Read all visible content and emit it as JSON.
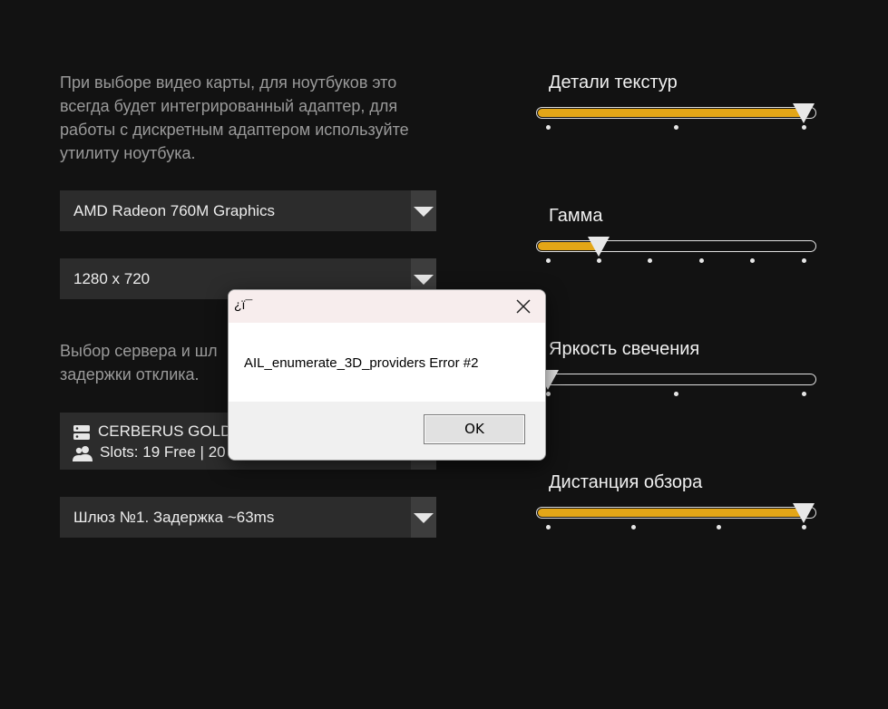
{
  "gpu": {
    "description": "При выборе видео карты, для ноутбуков это всегда будет интегрированный адаптер, для работы с дискретным адаптером используйте утилиту ноутбука.",
    "selected": "AMD Radeon 760M Graphics"
  },
  "resolution": {
    "selected": "1280 x 720"
  },
  "server": {
    "description": "Выбор сервера и шл… задержки отклика.",
    "desc_line1": "Выбор сервера и шл",
    "desc_line2": "задержки отклика.",
    "name": "CERBERUS GOLD8",
    "slots": "Slots: 19 Free | 20",
    "icons": [
      "server-icon",
      "users-icon"
    ]
  },
  "gateway": {
    "selected": "Шлюз №1. Задержка ~63ms"
  },
  "sliders": [
    {
      "label": "Детали текстур",
      "value": 1.0,
      "steps": 3
    },
    {
      "label": "Гамма",
      "value": 0.2,
      "steps": 6
    },
    {
      "label": "Яркость свечения",
      "value": 0.0,
      "steps": 3
    },
    {
      "label": "Дистанция обзора",
      "value": 1.0,
      "steps": 4
    }
  ],
  "dialog": {
    "title": "¿ї¯",
    "message": "AIL_enumerate_3D_providers Error #2",
    "ok_label": "OK"
  },
  "colors": {
    "background": "#121212",
    "accent": "#e3a617",
    "dropdown_bg": "#2c2c2c"
  }
}
